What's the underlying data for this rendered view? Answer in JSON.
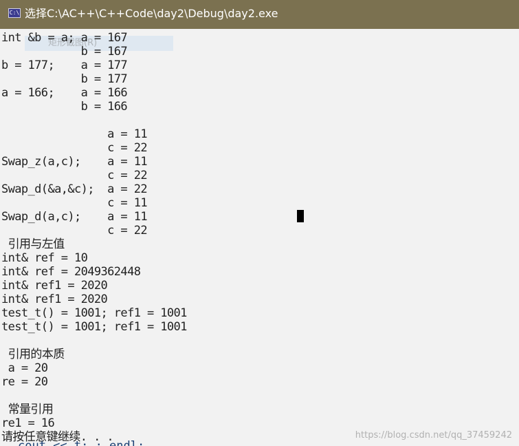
{
  "window": {
    "title": "选择C:\\AC++\\C++Code\\day2\\Debug\\day2.exe",
    "icon": "console-app-icon",
    "icon_glyph": "C:\\",
    "titlebar_color": "#7b7150"
  },
  "ghost_menu": {
    "label": "矩形截图(R)"
  },
  "console": {
    "lines": [
      "int &b = a; a = 167",
      "            b = 167",
      "b = 177;    a = 177",
      "            b = 177",
      "a = 166;    a = 166",
      "            b = 166",
      "",
      "                a = 11",
      "                c = 22",
      "Swap_z(a,c);    a = 11",
      "                c = 22",
      "Swap_d(&a,&c);  a = 22",
      "                c = 11",
      "Swap_d(a,c);    a = 11",
      "                c = 22",
      " 引用与左值",
      "int& ref = 10",
      "int& ref = 2049362448",
      "int& ref1 = 2020",
      "int& ref1 = 2020",
      "test_t() = 1001; ref1 = 1001",
      "test_t() = 1001; ref1 = 1001",
      "",
      " 引用的本质",
      " a = 20",
      "re = 20",
      "",
      " 常量引用",
      "re1 = 16",
      "请按任意键继续. . ."
    ]
  },
  "code_peek": "cout << t; ; endl;",
  "watermark": "https://blog.csdn.net/qq_37459242"
}
